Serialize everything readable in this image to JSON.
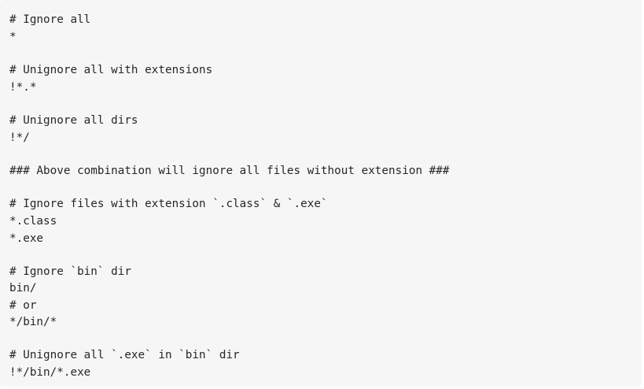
{
  "code_block": {
    "lines": [
      "# Ignore all",
      "*",
      "# Unignore all with extensions",
      "!*.*",
      "# Unignore all dirs",
      "!*/",
      "### Above combination will ignore all files without extension ###",
      "# Ignore files with extension `.class` & `.exe`",
      "*.class",
      "*.exe",
      "# Ignore `bin` dir",
      "bin/",
      "# or",
      "*/bin/*",
      "# Unignore all `.exe` in `bin` dir",
      "!*/bin/*.exe"
    ]
  }
}
